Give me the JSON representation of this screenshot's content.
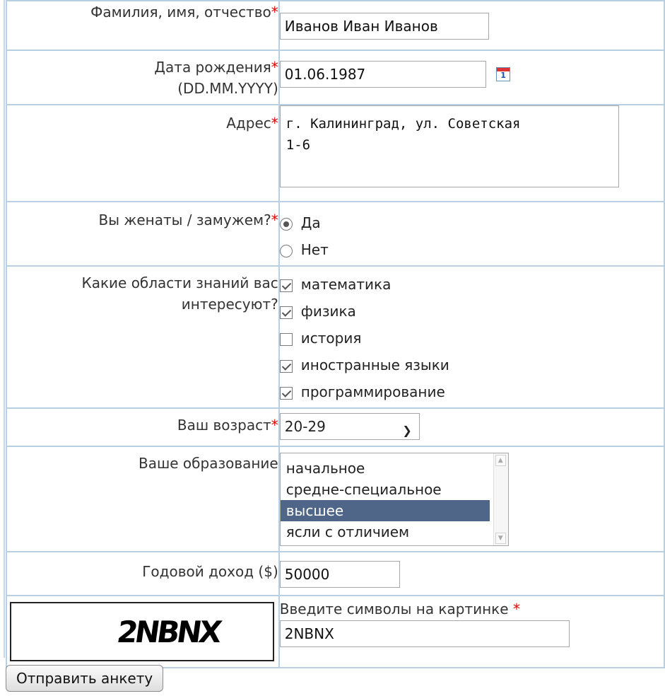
{
  "fields": {
    "fio": {
      "label": "Фамилия, имя, отчество",
      "required_mark": "*",
      "value": "Иванов Иван Иванов"
    },
    "birth": {
      "label_line1": "Дата рождения",
      "required_mark": "*",
      "label_line2": "(DD.MM.YYYY)",
      "value": "01.06.1987",
      "calendar_day": "1"
    },
    "address": {
      "label": "Адрес",
      "required_mark": "*",
      "value": "г. Калининград, ул. Советская\n1-6"
    },
    "married": {
      "label": "Вы женаты / замужем?",
      "required_mark": "*",
      "options": [
        {
          "label": "Да",
          "checked": true
        },
        {
          "label": "Нет",
          "checked": false
        }
      ]
    },
    "interests": {
      "label_line1": "Какие области знаний вас",
      "label_line2": "интересуют?",
      "options": [
        {
          "label": "математика",
          "checked": true
        },
        {
          "label": "физика",
          "checked": true
        },
        {
          "label": "история",
          "checked": false
        },
        {
          "label": "иностранные языки",
          "checked": true
        },
        {
          "label": "программирование",
          "checked": true
        }
      ]
    },
    "age": {
      "label": "Ваш возраст",
      "required_mark": "*",
      "selected": "20-29"
    },
    "education": {
      "label": "Ваше образование",
      "options": [
        "начальное",
        "средне-специальное",
        "высшее",
        "ясли с отличием"
      ],
      "selected_index": 2
    },
    "income": {
      "label": "Годовой доход ($)",
      "value": "50000"
    },
    "captcha": {
      "image_text": "2NBNX",
      "label": "Введите символы на картинке",
      "required_mark": "*",
      "value": "2NBNX"
    }
  },
  "submit_label": "Отправить анкету",
  "colors": {
    "border": "#b9cfe3",
    "required": "#e00000",
    "selected_bg": "#4f6688"
  }
}
